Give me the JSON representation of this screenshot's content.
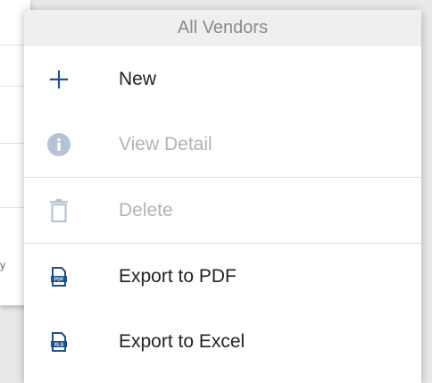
{
  "menu": {
    "title": "All Vendors",
    "items": [
      {
        "label": "New",
        "icon": "plus-icon",
        "enabled": true
      },
      {
        "label": "View Detail",
        "icon": "info-icon",
        "enabled": false
      },
      {
        "label": "Delete",
        "icon": "trash-icon",
        "enabled": false
      },
      {
        "label": "Export to PDF",
        "icon": "pdf-file-icon",
        "badge": "PDF",
        "enabled": true
      },
      {
        "label": "Export to Excel",
        "icon": "excel-file-icon",
        "badge": "XLS",
        "enabled": true
      }
    ]
  },
  "background": {
    "partial_text": "y"
  },
  "colors": {
    "accent": "#1f4f8f",
    "disabled_icon": "#b4c3d6",
    "disabled_text": "#b3b3b3",
    "header_bg": "#efefef"
  }
}
